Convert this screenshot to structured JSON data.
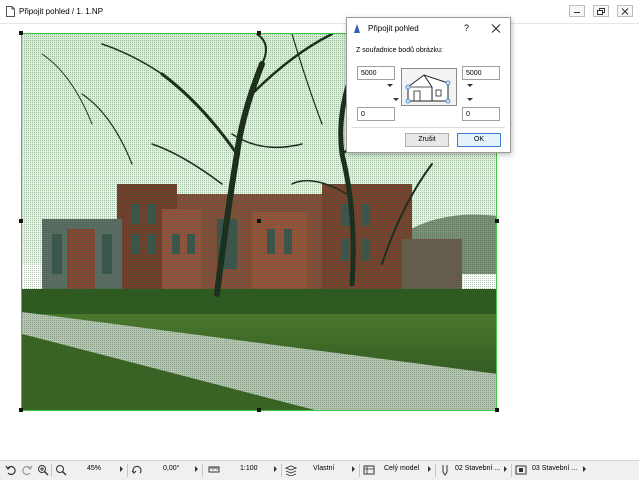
{
  "window": {
    "title": "Připojit pohled / 1. 1.NP",
    "buttons": [
      "minimize-icon",
      "restore-icon",
      "close-icon"
    ]
  },
  "dialog": {
    "title": "Připojit pohled",
    "help": "?",
    "subtitle": "Z souřadnice bodů obrázku:",
    "fields": {
      "top_left": "5000",
      "top_right": "5000",
      "bottom_left": "0",
      "bottom_right": "0"
    },
    "cancel_label": "Zrušit",
    "ok_label": "OK"
  },
  "statusbar": {
    "zoom": "45%",
    "angle": "0,00°",
    "scale": "1:100",
    "pen_set": "Vlastní",
    "model_view": "Celý model",
    "layer_combo": "02 Stavební ...",
    "dimension": "03 Stavební ..."
  },
  "colors": {
    "selection_border": "#3ec93e",
    "ok_accent": "#3c7fd6"
  }
}
